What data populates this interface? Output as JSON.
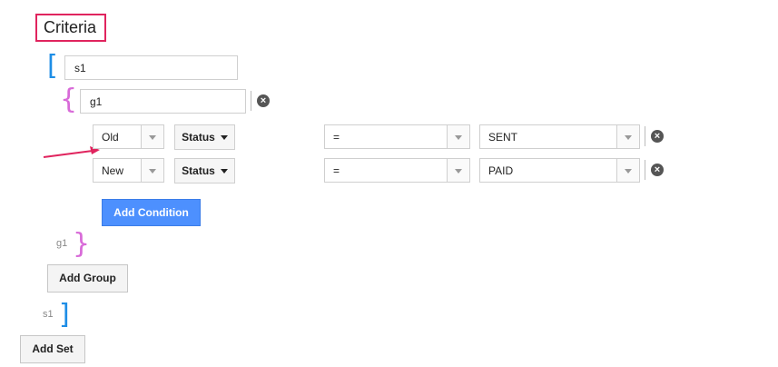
{
  "header": {
    "title": "Criteria"
  },
  "set": {
    "name": "s1",
    "open_bracket": "[",
    "close_bracket": "]",
    "close_tag": "s1"
  },
  "group": {
    "name": "g1",
    "open_bracket": "{",
    "close_bracket": "}",
    "close_tag": "g1"
  },
  "conditions": [
    {
      "qualifier": "Old",
      "field": "Status",
      "operator": "=",
      "value": "SENT"
    },
    {
      "qualifier": "New",
      "field": "Status",
      "operator": "=",
      "value": "PAID"
    }
  ],
  "icons": {
    "remove": "×"
  },
  "buttons": {
    "add_condition": "Add Condition",
    "add_group": "Add Group",
    "add_set": "Add Set"
  },
  "colors": {
    "highlight": "#e0245e",
    "set_bracket": "#1e8ee6",
    "group_bracket": "#d86ad8",
    "primary": "#4d90fe"
  }
}
